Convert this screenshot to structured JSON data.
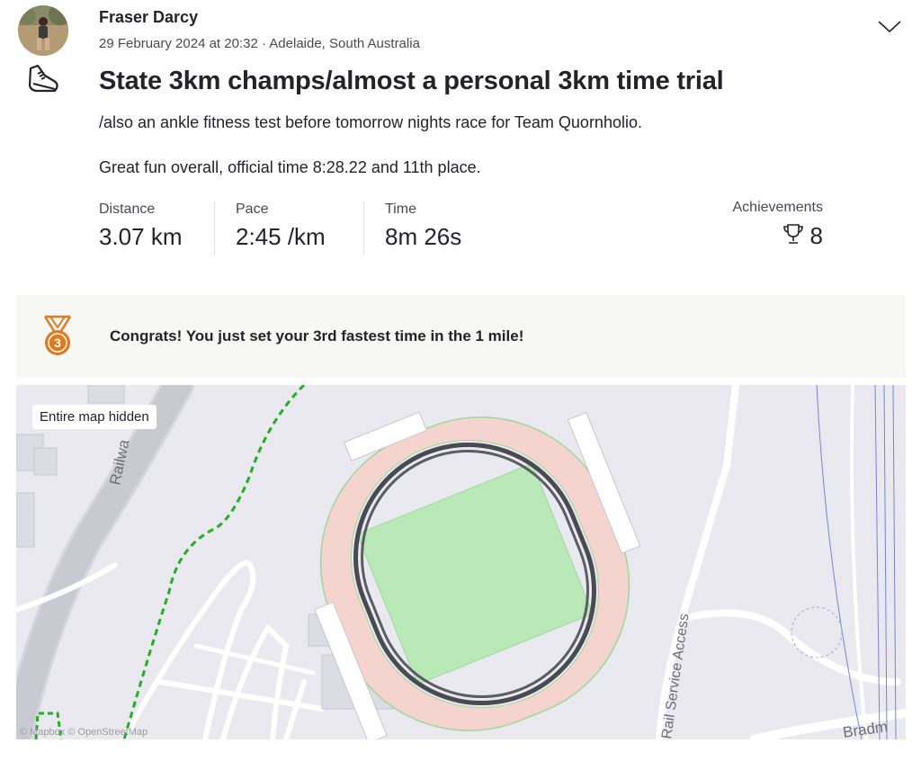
{
  "activity": {
    "athlete_name": "Fraser Darcy",
    "date_location": "29 February 2024 at 20:32 · Adelaide, South Australia",
    "title": "State 3km champs/almost a personal 3km time trial",
    "description_line1": "/also an ankle fitness test before tomorrow nights race for Team Quornholio.",
    "description_line2": "Great fun overall, official time 8:28.22 and 11th place.",
    "sport_icon": "shoe-icon",
    "menu_icon": "chevron-down-icon"
  },
  "stats": {
    "distance_label": "Distance",
    "distance_value": "3.07 km",
    "pace_label": "Pace",
    "pace_value": "2:45 /km",
    "time_label": "Time",
    "time_value": "8m 26s",
    "achievements_label": "Achievements",
    "achievements_value": "8",
    "achievements_icon": "trophy-icon"
  },
  "banner": {
    "text": "Congrats! You just set your 3rd fastest time in the 1 mile!",
    "medal_icon": "bronze-medal-icon",
    "medal_number": "3",
    "medal_color": "#e27a1c"
  },
  "map": {
    "overlay_label": "Entire map hidden",
    "attribution": "© Mapbox © OpenStreetMap",
    "street_railway": "Railwa",
    "street_service": "Rail Service Access",
    "street_bradman": "Bradm",
    "route_color": "#4a4a52",
    "walking_path_color": "#22b022",
    "field_color": "#b9e9b7",
    "track_color": "#f5d3cf"
  }
}
